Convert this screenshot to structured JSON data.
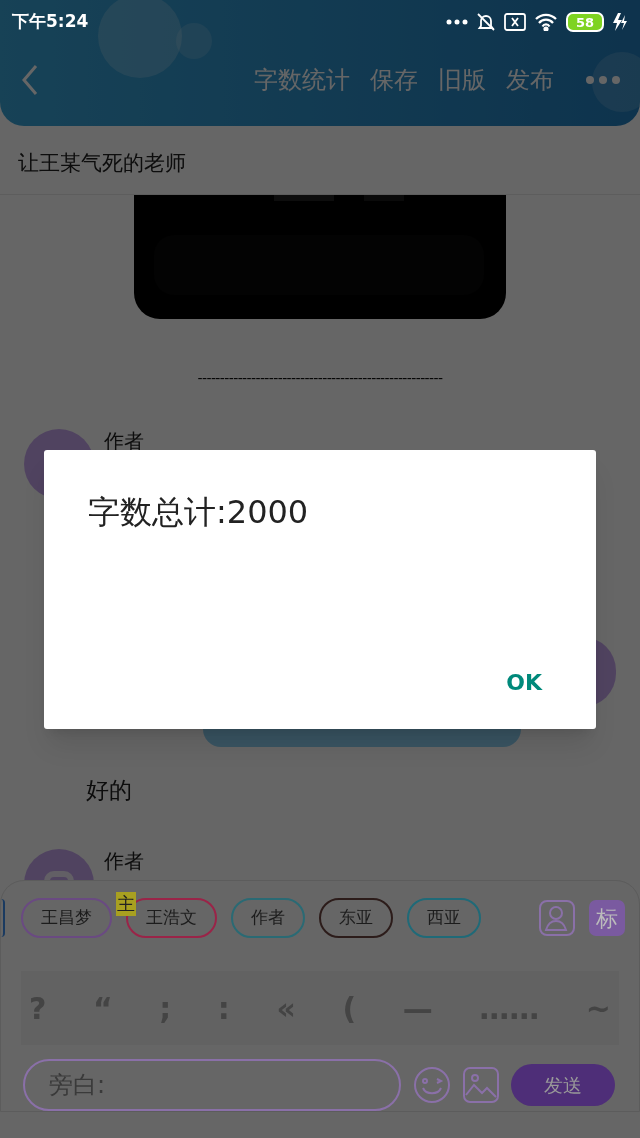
{
  "status_bar": {
    "time": "下午5:24",
    "battery": "58"
  },
  "header": {
    "actions": [
      "字数统计",
      "保存",
      "旧版",
      "发布"
    ]
  },
  "document": {
    "title": "让王某气死的老师",
    "separator": "-------------------------------------------------------"
  },
  "messages": [
    {
      "kind": "left",
      "author": "作者"
    },
    {
      "kind": "right"
    },
    {
      "kind": "continuation",
      "text": "好的"
    },
    {
      "kind": "left",
      "author": "作者"
    }
  ],
  "dialog": {
    "message": "字数总计:2000",
    "button": "OK"
  },
  "composer": {
    "roles": [
      {
        "label": "王昌梦",
        "color": "#6a4a82",
        "main": false
      },
      {
        "label": "王浩文",
        "color": "#9a2448",
        "main": true,
        "main_mark": "主"
      },
      {
        "label": "作者",
        "color": "#2a6a74",
        "main": false
      },
      {
        "label": "东亚",
        "color": "#2c1c1a",
        "main": false
      },
      {
        "label": "西亚",
        "color": "#1f6a78",
        "main": false
      }
    ],
    "mark_button": "标",
    "punctuation": [
      "?",
      "“",
      ";",
      ":",
      "«",
      "(",
      "—",
      "……",
      "~"
    ],
    "input": {
      "placeholder": "旁白:"
    },
    "send": "发送"
  }
}
